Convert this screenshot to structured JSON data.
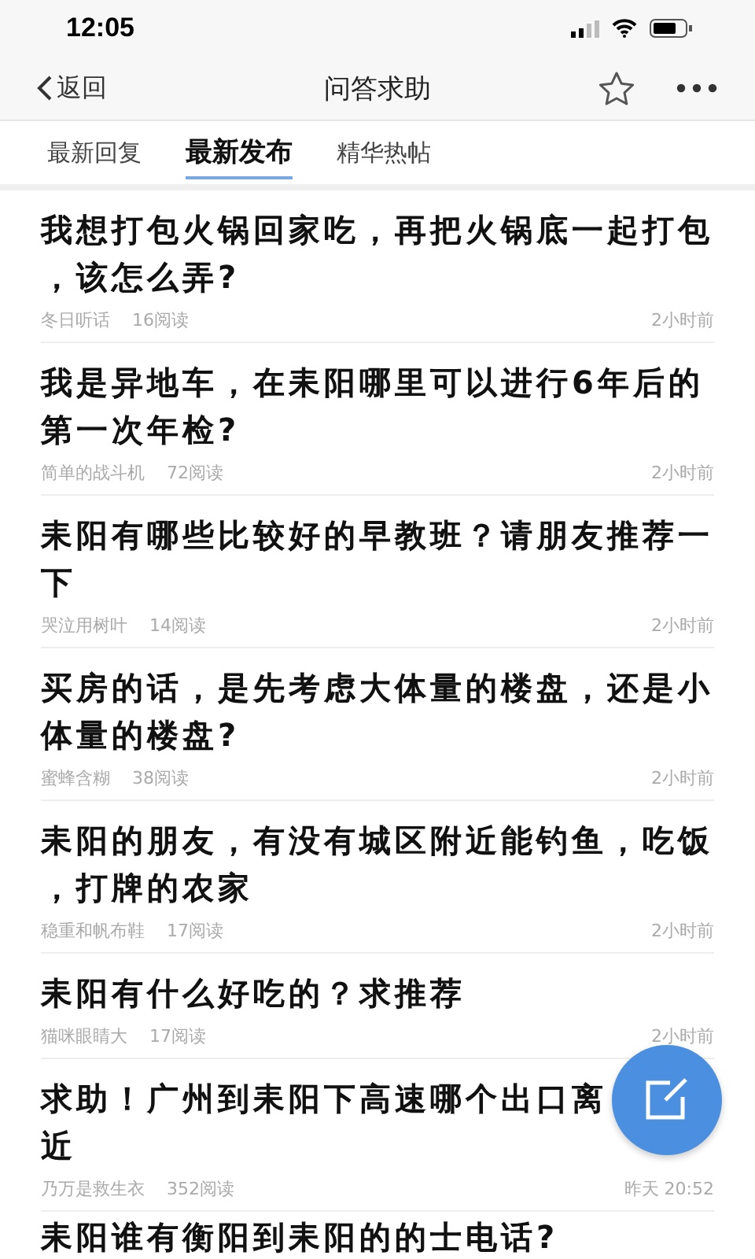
{
  "status_bar": {
    "time": "12:05"
  },
  "nav": {
    "back": "返回",
    "title": "问答求助"
  },
  "tabs": [
    {
      "label": "最新回复",
      "selected": false
    },
    {
      "label": "最新发布",
      "selected": true
    },
    {
      "label": "精华热帖",
      "selected": false
    }
  ],
  "posts": [
    {
      "lines": [
        "我想打包火锅回家吃，再把火锅底一起打包",
        "，该怎么弄?"
      ],
      "author": "冬日听话",
      "reads": "16阅读",
      "time": "2小时前"
    },
    {
      "lines": [
        "我是异地车，在耒阳哪里可以进行6年后的",
        "第一次年检?"
      ],
      "author": "简单的战斗机",
      "reads": "72阅读",
      "time": "2小时前"
    },
    {
      "lines": [
        "耒阳有哪些比较好的早教班？请朋友推荐一",
        "下"
      ],
      "author": "哭泣用树叶",
      "reads": "14阅读",
      "time": "2小时前"
    },
    {
      "lines": [
        "买房的话，是先考虑大体量的楼盘，还是小",
        "体量的楼盘?"
      ],
      "author": "蜜蜂含糊",
      "reads": "38阅读",
      "time": "2小时前"
    },
    {
      "lines": [
        "耒阳的朋友，有没有城区附近能钓鱼，吃饭",
        "，打牌的农家"
      ],
      "author": "稳重和帆布鞋",
      "reads": "17阅读",
      "time": "2小时前"
    },
    {
      "lines": [
        "耒阳有什么好吃的？求推荐"
      ],
      "author": "猫咪眼睛大",
      "reads": "17阅读",
      "time": "2小时前"
    },
    {
      "lines": [
        "求助！广州到耒阳下高速哪个出口离",
        "近"
      ],
      "author": "乃万是救生衣",
      "reads": "352阅读",
      "time": "昨天 20:52"
    },
    {
      "lines": [
        "耒阳谁有衡阳到耒阳的的士电话?"
      ]
    }
  ]
}
